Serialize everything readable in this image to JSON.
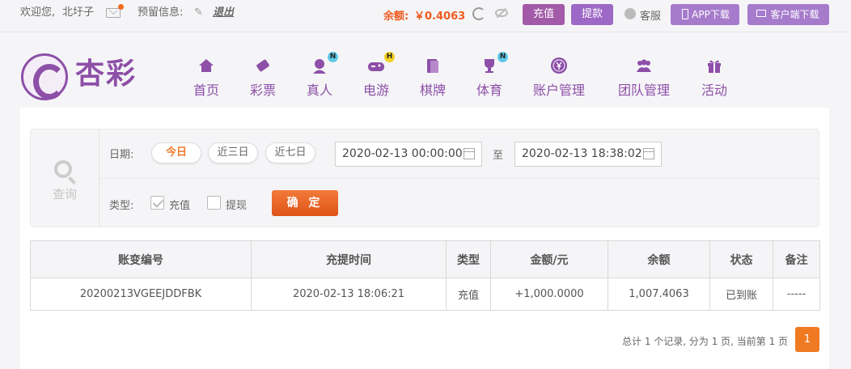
{
  "topbar": {
    "welcome": "欢迎您,",
    "username": "北圩子",
    "reserved_info": "预留信息:",
    "logout": "退出",
    "balance_label": "余额:",
    "balance_value": "￥0.4063",
    "recharge": "充值",
    "withdraw": "提款",
    "customer_service": "客服",
    "app_download": "APP下载",
    "client_download": "客户端下载"
  },
  "brand": {
    "name": "杏彩"
  },
  "nav": {
    "items": [
      {
        "label": "首页",
        "icon": "home-icon"
      },
      {
        "label": "彩票",
        "icon": "lottery-icon"
      },
      {
        "label": "真人",
        "icon": "live-dealer-icon",
        "badge": "N"
      },
      {
        "label": "电游",
        "icon": "gamepad-icon",
        "badge": "H"
      },
      {
        "label": "棋牌",
        "icon": "cards-icon"
      },
      {
        "label": "体育",
        "icon": "trophy-icon",
        "badge": "N"
      },
      {
        "label": "账户管理",
        "icon": "yen-coin-icon"
      },
      {
        "label": "团队管理",
        "icon": "team-icon"
      },
      {
        "label": "活动",
        "icon": "gift-icon"
      }
    ]
  },
  "filter": {
    "query_label": "查询",
    "date_label": "日期:",
    "ranges": [
      "今日",
      "近三日",
      "近七日"
    ],
    "active_range": "今日",
    "start_date": "2020-02-13 00:00:00",
    "to_label": "至",
    "end_date": "2020-02-13 18:38:02",
    "type_label": "类型:",
    "types": [
      {
        "label": "充值",
        "checked": true
      },
      {
        "label": "提现",
        "checked": false
      }
    ],
    "confirm": "确 定"
  },
  "table": {
    "headers": [
      "账变编号",
      "充提时间",
      "类型",
      "金额/元",
      "余额",
      "状态",
      "备注"
    ],
    "rows": [
      [
        "20200213VGEEJDDFBK",
        "2020-02-13 18:06:21",
        "充值",
        "+1,000.0000",
        "1,007.4063",
        "已到账",
        "-----"
      ]
    ]
  },
  "pagination": {
    "summary": "总计 1 个记录, 分为 1 页, 当前第 1 页",
    "current": "1"
  },
  "colors": {
    "brand_purple": "#8d4fa8",
    "accent_orange": "#f07a22",
    "amount_red": "#d3262a",
    "status_green": "#3c9b39"
  }
}
